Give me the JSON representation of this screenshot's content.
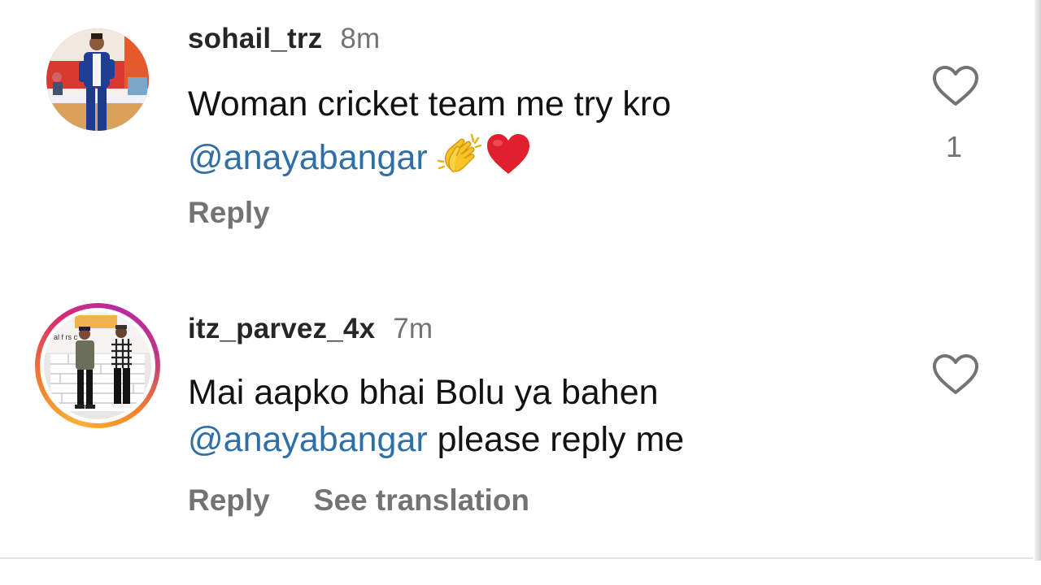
{
  "comments": [
    {
      "username": "sohail_trz",
      "time": "8m",
      "line1": "Woman cricket team me try kro",
      "mention": "@anayabangar",
      "line2_rest": "",
      "emojis": [
        "clapping-hands",
        "red-heart"
      ],
      "actions": {
        "reply": "Reply"
      },
      "like_count": "1",
      "avatar": "avatar-photo-man-in-suit"
    },
    {
      "username": "itz_parvez_4x",
      "time": "7m",
      "line1": "Mai aapko bhai Bolu ya bahen",
      "mention": "@anayabangar",
      "line2_rest": " please reply me",
      "actions": {
        "reply": "Reply",
        "see_translation": "See translation"
      },
      "like_count": "",
      "avatar": "avatar-photo-two-men-story-ring",
      "avatar_sign_text": "al f  rs  c"
    }
  ],
  "colors": {
    "username": "#262626",
    "muted": "#737373",
    "mention": "#2f6fa8",
    "story_ring_start": "#f9b035",
    "story_ring_end": "#c13584"
  }
}
